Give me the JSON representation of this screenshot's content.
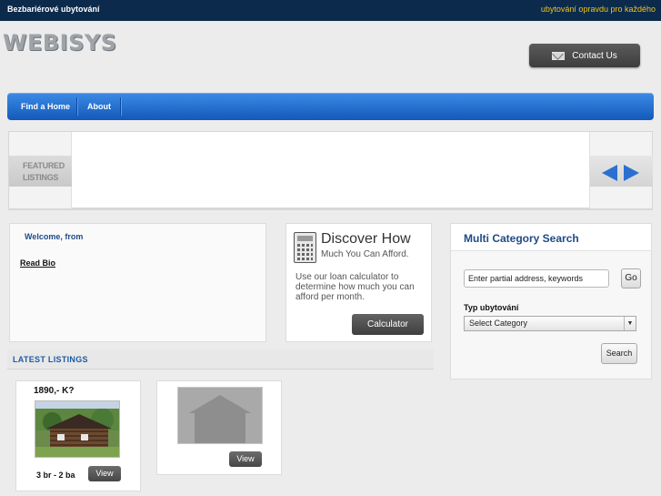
{
  "topbar": {
    "site_name": "Bezbariérové ubytování",
    "tagline": "ubytování opravdu pro každého"
  },
  "logo": {
    "text": "WEBISYS"
  },
  "contact": {
    "label": "Contact Us",
    "icon": "mail-icon"
  },
  "nav": {
    "items": [
      {
        "label": "Find a Home"
      },
      {
        "label": "About"
      }
    ]
  },
  "featured": {
    "label_line1": "FEATURED",
    "label_line2": "LISTINGS",
    "prev_icon": "arrow-left-icon",
    "next_icon": "arrow-right-icon",
    "arrow_color": "#2c6fd1"
  },
  "welcome": {
    "title": "Welcome, from",
    "bio_link": "Read Bio"
  },
  "calculator": {
    "heading": "Discover How",
    "subheading": "Much You Can Afford.",
    "description": "Use our loan calculator to determine how much you can afford per month.",
    "button": "Calculator",
    "icon": "calculator-icon"
  },
  "latest": {
    "title": "LATEST LISTINGS",
    "listings": [
      {
        "price": "1890,- K?",
        "beds": "3 br - 2 ba",
        "view": "View"
      },
      {
        "view": "View"
      }
    ]
  },
  "search": {
    "title": "Multi Category Search",
    "keywords_value": "Enter partial address, keywords",
    "go": "Go",
    "category_label": "Typ ubytování",
    "category_selected": "Select Category",
    "search_button": "Search"
  },
  "colors": {
    "topbar_bg": "#0c2a4b",
    "tagline": "#f0c419",
    "nav_blue": "#1f6fd0",
    "heading_blue": "#1e4b86"
  }
}
